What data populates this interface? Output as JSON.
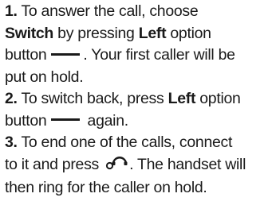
{
  "steps": [
    {
      "number": "1.",
      "line1": "To answer the call, choose",
      "switch_kw": "Switch",
      "by_pressing": "by pressing",
      "left_kw": "Left",
      "option": "option",
      "button": "button",
      "after_button": ". Your first caller will be",
      "line4": "put on hold."
    },
    {
      "number": "2.",
      "text": "To switch back, press",
      "left_kw": "Left",
      "option": "option",
      "button": "button",
      "again": "again."
    },
    {
      "number": "3.",
      "line1": "To end one of the calls, connect",
      "to_it": "to it and press",
      "after_icon": ". The handset will",
      "line3": "then ring for the caller on hold."
    }
  ],
  "icons": {
    "option_key": "left-option-key-icon",
    "end_call": "end-call-key-icon"
  },
  "colors": {
    "text": "#1a1a1a"
  }
}
